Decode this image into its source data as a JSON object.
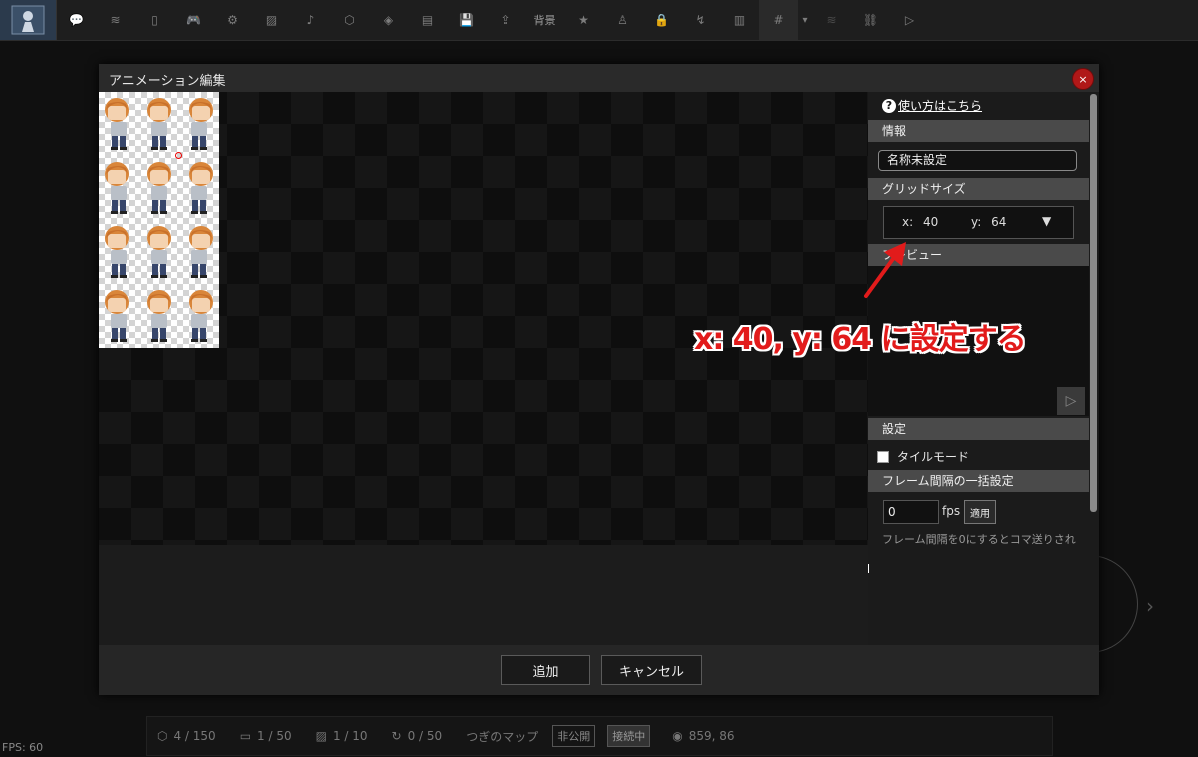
{
  "toolbar": {
    "items": [
      {
        "name": "speech-bubble-icon",
        "glyph": "💬"
      },
      {
        "name": "layers-icon",
        "glyph": "≋"
      },
      {
        "name": "door-icon",
        "glyph": "▯"
      },
      {
        "name": "gamepad-icon",
        "glyph": "🎮"
      },
      {
        "name": "gear-icon",
        "glyph": "⚙"
      },
      {
        "name": "image-icon",
        "glyph": "▨"
      },
      {
        "name": "music-note-icon",
        "glyph": "♪"
      },
      {
        "name": "cube-icon",
        "glyph": "⬡"
      },
      {
        "name": "small-cube-icon",
        "glyph": "◈"
      },
      {
        "name": "film-icon",
        "glyph": "▤"
      },
      {
        "name": "save-icon",
        "glyph": "💾"
      },
      {
        "name": "export-icon",
        "glyph": "⇪"
      }
    ],
    "background_label": "背景",
    "items_after": [
      {
        "name": "star-icon",
        "glyph": "★"
      },
      {
        "name": "person-icon",
        "glyph": "♙"
      },
      {
        "name": "lock-icon",
        "glyph": "🔒"
      },
      {
        "name": "path-icon",
        "glyph": "↯"
      },
      {
        "name": "battery-icon",
        "glyph": "▥"
      },
      {
        "name": "grid-icon",
        "glyph": "#"
      }
    ],
    "caret_glyph": "▾",
    "tail_items": [
      {
        "name": "stack-icon",
        "glyph": "≋"
      },
      {
        "name": "link-icon",
        "glyph": "⛓"
      },
      {
        "name": "play-icon",
        "glyph": "▷"
      }
    ]
  },
  "dialog": {
    "title": "アニメーション編集",
    "close_glyph": "×",
    "help_glyph": "?",
    "help_link": "使い方はこちら",
    "sections": {
      "info": "情報",
      "grid_size": "グリッドサイズ",
      "preview": "プレビュー",
      "settings": "設定",
      "frame_interval": "フレーム間隔の一括設定"
    },
    "name_value": "名称未設定",
    "grid": {
      "x_label": "x:",
      "x_value": "40",
      "y_label": "y:",
      "y_value": "64",
      "caret": "▼"
    },
    "play_glyph": "▷",
    "tile_mode_label": "タイルモード",
    "fps_value": "0",
    "fps_unit": "fps",
    "apply_label": "適用",
    "hint": "フレーム間隔を0にするとコマ送りされ",
    "add_label": "追加",
    "cancel_label": "キャンセル"
  },
  "annotation": {
    "text": "x: 40, y: 64 に設定する",
    "color": "#e21b1b"
  },
  "status_bar": {
    "objects": "4 / 150",
    "frames": "1 / 50",
    "images": "1 / 10",
    "transitions": "0 / 50",
    "next_map_label": "つぎのマップ",
    "private_badge": "非公開",
    "connected_badge": "接続中",
    "coords": "859, 86"
  },
  "fps_readout": "FPS: 60",
  "colors": {
    "accent": "#e21b1b",
    "close": "#b01818",
    "section_header": "#4a4a4a"
  }
}
